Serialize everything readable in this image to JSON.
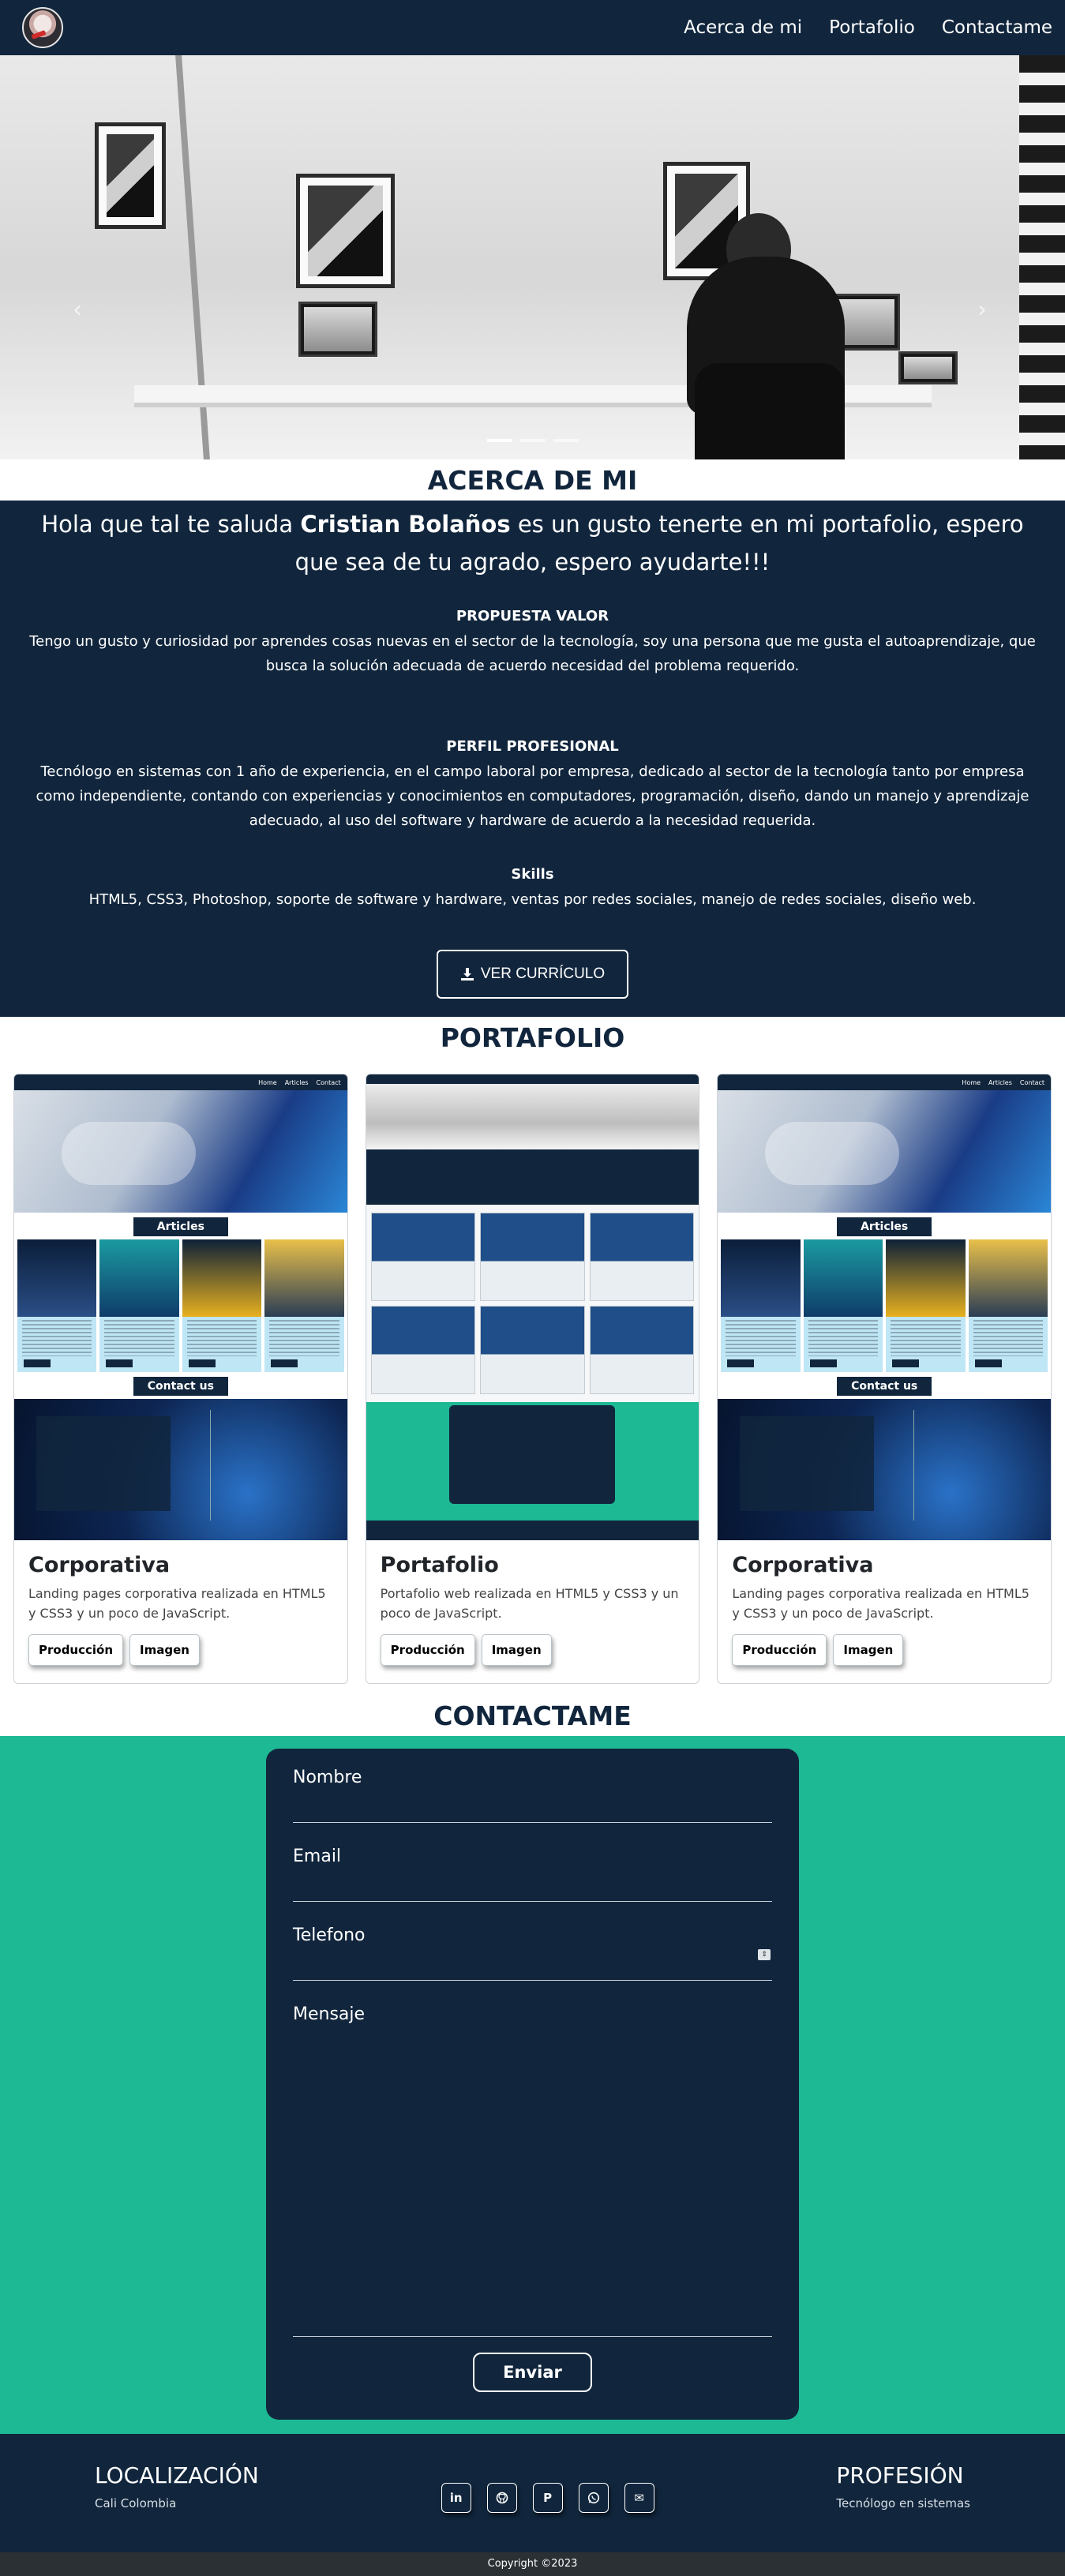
{
  "navbar": {
    "links": [
      "Acerca de mi",
      "Portafolio",
      "Contactame"
    ]
  },
  "hero": {
    "prev": "‹",
    "next": "›",
    "slide_count": 3,
    "active_slide": 1
  },
  "about": {
    "title": "ACERCA DE MI",
    "greeting_pre": "Hola que tal te saluda ",
    "greeting_name": "Cristian Bolaños",
    "greeting_post": " es un gusto tenerte en mi portafolio, espero que sea de tu agrado, espero ayudarte!!!",
    "value_title": "PROPUESTA VALOR",
    "value_text": "Tengo un gusto y curiosidad por aprendes cosas nuevas en el sector de la tecnología, soy una persona que me gusta el autoaprendizaje, que busca la solución adecuada de acuerdo necesidad del problema requerido.",
    "profile_title": "PERFIL PROFESIONAL",
    "profile_text": "Tecnólogo en sistemas con 1 año de experiencia, en el campo laboral por empresa, dedicado al sector de la tecnología tanto por empresa como independiente, contando con experiencias y conocimientos en computadores, programación, diseño, dando un manejo y aprendizaje adecuado, al uso del software y hardware de acuerdo a la necesidad requerida.",
    "skills_title": "Skills",
    "skills_text": "HTML5, CSS3, Photoshop, soporte de software y hardware, ventas por redes sociales, manejo de redes sociales, diseño web.",
    "cv_button": "VER CURRÍCULO"
  },
  "portfolio": {
    "title": "PORTAFOLIO",
    "cards": [
      {
        "title": "Corporativa",
        "text": "Landing pages corporativa realizada en HTML5 y CSS3 y un poco de JavaScript.",
        "btn1": "Producción",
        "btn2": "Imagen"
      },
      {
        "title": "Portafolio",
        "text": "Portafolio web realizada en HTML5 y CSS3 y un poco de JavaScript.",
        "btn1": "Producción",
        "btn2": "Imagen"
      },
      {
        "title": "Corporativa",
        "text": "Landing pages corporativa realizada en HTML5 y CSS3 y un poco de JavaScript.",
        "btn1": "Producción",
        "btn2": "Imagen"
      }
    ],
    "thumb": {
      "articles": "Articles",
      "contact": "Contact us",
      "nav": [
        "Home",
        "Articles",
        "Contact"
      ]
    }
  },
  "contact": {
    "title": "CONTACTAME",
    "name_label": "Nombre",
    "email_label": "Email",
    "phone_label": "Telefono",
    "message_label": "Mensaje",
    "submit": "Enviar"
  },
  "footer": {
    "location_title": "LOCALIZACIÓN",
    "location_text": "Cali Colombia",
    "profession_title": "PROFESIÓN",
    "profession_text": "Tecnólogo en sistemas",
    "socials": [
      "in",
      "gh",
      "P",
      "W",
      "✉"
    ],
    "copyright": "Copyright ©2023"
  },
  "colors": {
    "primary": "#11263d",
    "accent": "#1db894"
  }
}
